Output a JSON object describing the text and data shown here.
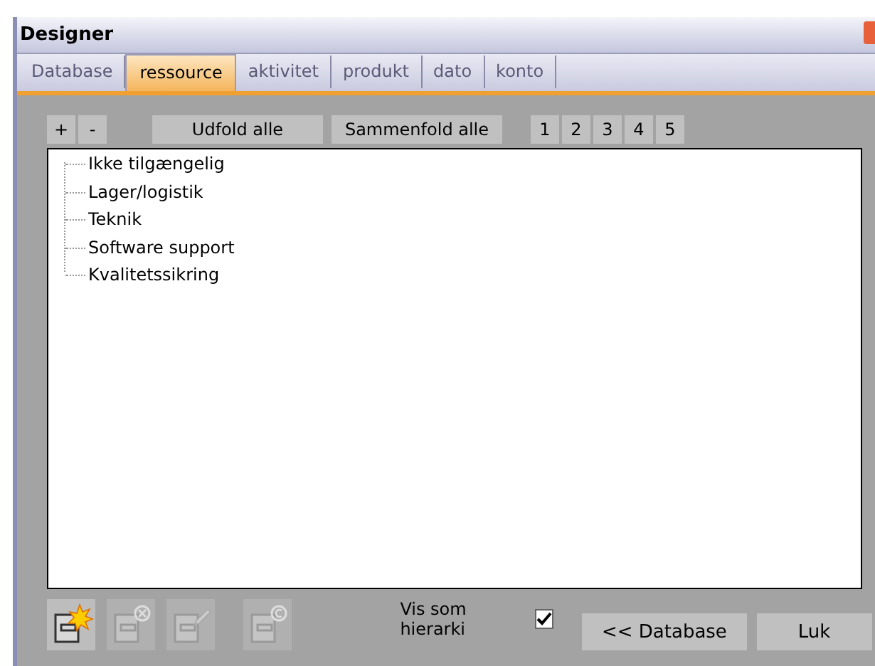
{
  "window": {
    "title": "Designer"
  },
  "tabs": [
    {
      "label": "Database",
      "selected": false
    },
    {
      "label": "ressource",
      "selected": true
    },
    {
      "label": "aktivitet",
      "selected": false
    },
    {
      "label": "produkt",
      "selected": false
    },
    {
      "label": "dato",
      "selected": false
    },
    {
      "label": "konto",
      "selected": false
    }
  ],
  "toolbar": {
    "small_buttons": [
      "+",
      "-"
    ],
    "buttons": [
      "Udfold alle",
      "Sammenfold alle"
    ],
    "level_buttons": [
      "1",
      "2",
      "3",
      "4",
      "5"
    ]
  },
  "tree": {
    "items": [
      {
        "label": "Ikke tilgængelig"
      },
      {
        "label": "Lager/logistik"
      },
      {
        "label": "Teknik"
      },
      {
        "label": "Software support"
      },
      {
        "label": "Kvalitetssikring"
      }
    ]
  },
  "actions": [
    {
      "kind": "new",
      "disabled": false
    },
    {
      "kind": "delete",
      "disabled": true
    },
    {
      "kind": "edit",
      "disabled": true
    },
    {
      "kind": "copy",
      "disabled": true
    }
  ],
  "hierarchy": {
    "label": "Vis som hierarki",
    "checked": true
  },
  "buttons": [
    "<< Database",
    "Luk"
  ]
}
